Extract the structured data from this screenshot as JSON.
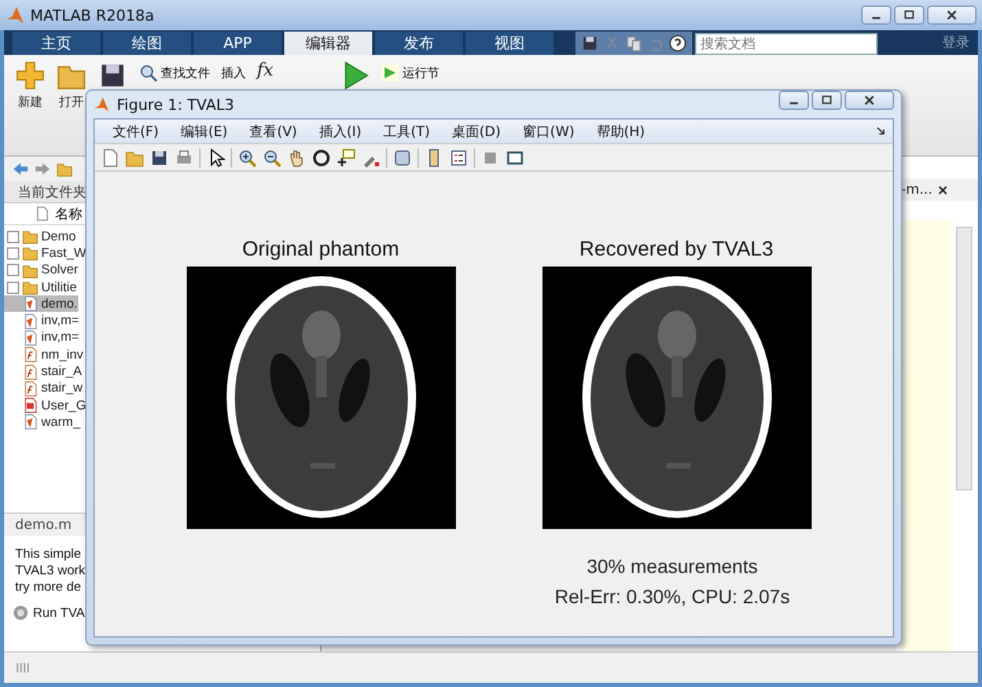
{
  "window": {
    "title": "MATLAB R2018a"
  },
  "tabs": [
    {
      "label": "主页",
      "selected": false
    },
    {
      "label": "绘图",
      "selected": false
    },
    {
      "label": "APP",
      "selected": false
    },
    {
      "label": "编辑器",
      "selected": true
    },
    {
      "label": "发布",
      "selected": false
    },
    {
      "label": "视图",
      "selected": false
    }
  ],
  "search": {
    "placeholder": "搜索文档"
  },
  "sign_in": "登录",
  "toolstrip": {
    "new": "新建",
    "open": "打开",
    "find_files": "查找文件",
    "insert": "插入",
    "function": "fx",
    "run_section": "运行节"
  },
  "current_folder": {
    "title": "当前文件夹",
    "column": "名称",
    "items": [
      {
        "name": "Demo",
        "kind": "folder",
        "selected": false
      },
      {
        "name": "Fast_W",
        "kind": "folder",
        "selected": false
      },
      {
        "name": "Solver",
        "kind": "folder",
        "selected": false
      },
      {
        "name": "Utilitie",
        "kind": "folder",
        "selected": false
      },
      {
        "name": "demo.",
        "kind": "script",
        "selected": true
      },
      {
        "name": "inv,m=",
        "kind": "script",
        "selected": false
      },
      {
        "name": "inv,m=",
        "kind": "script",
        "selected": false
      },
      {
        "name": "nm_inv",
        "kind": "function",
        "selected": false
      },
      {
        "name": "stair_A",
        "kind": "function",
        "selected": false
      },
      {
        "name": "stair_w",
        "kind": "function",
        "selected": false
      },
      {
        "name": "User_G",
        "kind": "pdf",
        "selected": false
      },
      {
        "name": "warm_",
        "kind": "script",
        "selected": false
      }
    ]
  },
  "details": {
    "title": "demo.m",
    "lines": [
      "This simple",
      "TVAL3 work",
      "try more de"
    ],
    "link": "Run TVA"
  },
  "right_panel": {
    "tab": "-m..."
  },
  "figure": {
    "title": "Figure 1: TVAL3",
    "menu": [
      "文件(F)",
      "编辑(E)",
      "查看(V)",
      "插入(I)",
      "工具(T)",
      "桌面(D)",
      "窗口(W)",
      "帮助(H)"
    ],
    "panels": [
      {
        "title": "Original phantom"
      },
      {
        "title": "Recovered by TVAL3"
      }
    ],
    "caption": [
      "30% measurements",
      "Rel-Err: 0.30%, CPU: 2.07s"
    ]
  }
}
